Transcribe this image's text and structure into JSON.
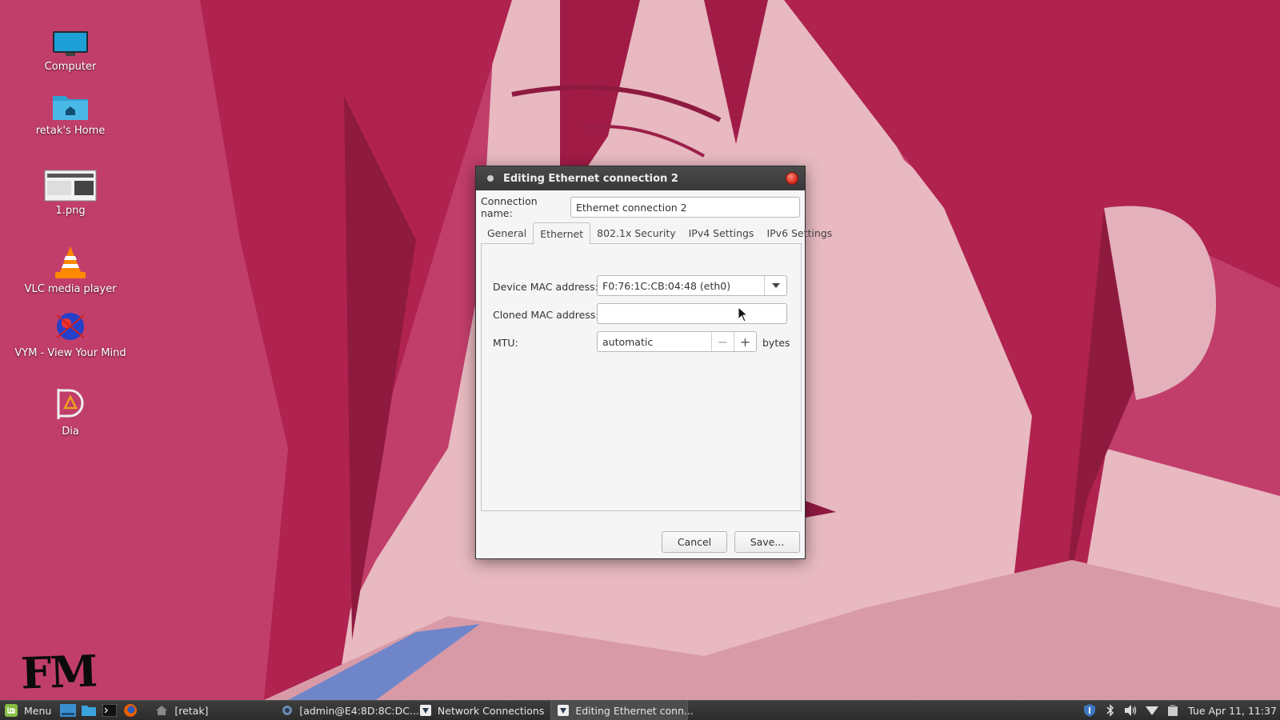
{
  "desktop": {
    "icons": [
      {
        "label": "Computer",
        "icon": "monitor-icon"
      },
      {
        "label": "retak's Home",
        "icon": "home-folder-icon"
      },
      {
        "label": "1.png",
        "icon": "image-file-icon"
      },
      {
        "label": "VLC media player",
        "icon": "vlc-cone-icon"
      },
      {
        "label": "VYM - View Your Mind",
        "icon": "vym-icon"
      },
      {
        "label": "Dia",
        "icon": "dia-icon"
      }
    ],
    "logo_text": "FM"
  },
  "dialog": {
    "title": "Editing Ethernet connection 2",
    "connection_name_label": "Connection name:",
    "connection_name_value": "Ethernet connection 2",
    "tabs": [
      {
        "label": "General",
        "active": false
      },
      {
        "label": "Ethernet",
        "active": true
      },
      {
        "label": "802.1x Security",
        "active": false
      },
      {
        "label": "IPv4 Settings",
        "active": false
      },
      {
        "label": "IPv6 Settings",
        "active": false
      }
    ],
    "ethernet": {
      "device_mac_label": "Device MAC address:",
      "device_mac_value": "F0:76:1C:CB:04:48 (eth0)",
      "cloned_mac_label": "Cloned MAC address:",
      "cloned_mac_value": "",
      "mtu_label": "MTU:",
      "mtu_value": "automatic",
      "mtu_unit": "bytes"
    },
    "buttons": {
      "cancel": "Cancel",
      "save": "Save..."
    }
  },
  "taskbar": {
    "menu_label": "Menu",
    "windows": [
      {
        "label": "[retak]",
        "icon": "home-icon",
        "active": false
      },
      {
        "label": "[admin@E4:8D:8C:DC...",
        "icon": "winbox-icon",
        "active": false
      },
      {
        "label": "Network Connections",
        "icon": "network-icon",
        "active": false
      },
      {
        "label": "Editing Ethernet conn...",
        "icon": "network-icon",
        "active": true
      }
    ],
    "clock": "Tue Apr 11, 11:37"
  },
  "colors": {
    "wallpaper": "#c13e6a",
    "taskbar": "#333333",
    "accent_green": "#86be43"
  }
}
